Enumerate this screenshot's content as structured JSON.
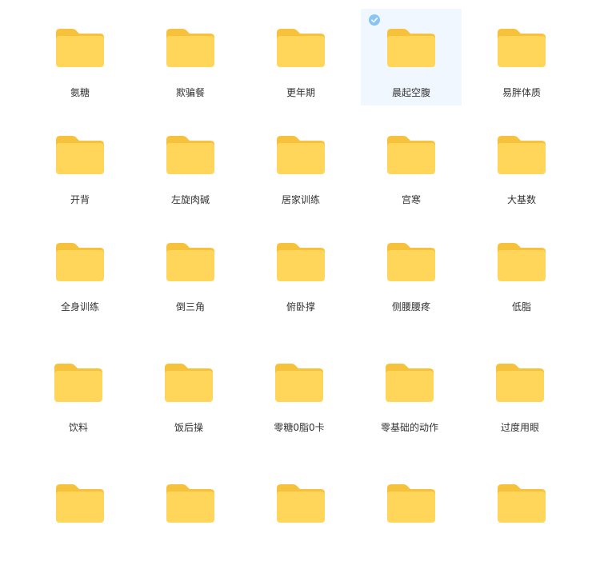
{
  "colors": {
    "folder_body": "#ffd659",
    "folder_tab": "#f7c23b",
    "selected_bg": "#f1f7fe",
    "check": "#88c5f4",
    "label": "#333333"
  },
  "folders": [
    {
      "name": "氨糖",
      "selected": false
    },
    {
      "name": "欺骗餐",
      "selected": false
    },
    {
      "name": "更年期",
      "selected": false
    },
    {
      "name": "晨起空腹",
      "selected": true
    },
    {
      "name": "易胖体质",
      "selected": false
    },
    {
      "name": "开背",
      "selected": false
    },
    {
      "name": "左旋肉碱",
      "selected": false
    },
    {
      "name": "居家训练",
      "selected": false
    },
    {
      "name": "宫寒",
      "selected": false
    },
    {
      "name": "大基数",
      "selected": false
    },
    {
      "name": "全身训练",
      "selected": false
    },
    {
      "name": "倒三角",
      "selected": false
    },
    {
      "name": "俯卧撑",
      "selected": false
    },
    {
      "name": "侧腰腰疼",
      "selected": false
    },
    {
      "name": "低脂",
      "selected": false
    },
    {
      "name": "饮料",
      "selected": false
    },
    {
      "name": "饭后操",
      "selected": false
    },
    {
      "name": "零糖0脂0卡",
      "selected": false
    },
    {
      "name": "零基础的动作",
      "selected": false
    },
    {
      "name": "过度用眼",
      "selected": false
    },
    {
      "name": "",
      "selected": false
    },
    {
      "name": "",
      "selected": false
    },
    {
      "name": "",
      "selected": false
    },
    {
      "name": "",
      "selected": false
    },
    {
      "name": "",
      "selected": false
    }
  ]
}
